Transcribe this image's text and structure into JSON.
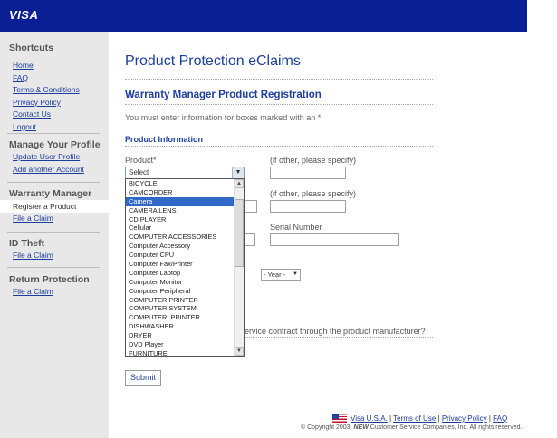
{
  "header": {
    "logo": "VISA"
  },
  "sidebar": {
    "shortcuts": {
      "title": "Shortcuts",
      "links": [
        "Home",
        "FAQ",
        "Terms & Conditions",
        "Privacy Policy",
        "Contact Us",
        "Logout"
      ]
    },
    "profile": {
      "title": "Manage Your Profile",
      "links": [
        "Update User Profile",
        "Add another Account"
      ]
    },
    "warranty": {
      "title": "Warranty Manager",
      "active": "Register a Product",
      "link": "File a Claim"
    },
    "idtheft": {
      "title": "ID Theft",
      "link": "File a Claim"
    },
    "returns": {
      "title": "Return Protection",
      "link": "File a Claim"
    }
  },
  "main": {
    "title": "Product Protection eClaims",
    "subtitle": "Warranty Manager Product Registration",
    "required_note": "You must enter information for boxes marked with an *",
    "section": "Product Information",
    "product_label": "Product*",
    "if_other_1": "(if other, please specify)",
    "if_other_2": "(if other, please specify)",
    "serial_label": "Serial Number",
    "product_select_value": "Select",
    "year_select": "- Year -",
    "question_partial": "ervice contract through the product manufacturer?",
    "submit_label": "Submit",
    "dropdown_options": [
      "BICYCLE",
      "CAMCORDER",
      "Camera",
      "CAMERA LENS",
      "CD PLAYER",
      "Cellular",
      "COMPUTER ACCESSORIES",
      "Computer Accessory",
      "Computer CPU",
      "Computer Fax/Printer",
      "Computer Laptop",
      "Computer Monitor",
      "Computer Peripheral",
      "COMPUTER PRINTER",
      "COMPUTER SYSTEM",
      "COMPUTER, PRINTER",
      "DISHWASHER",
      "DRYER",
      "DVD Player",
      "FURNITURE"
    ],
    "dropdown_selected": "Camera"
  },
  "footer": {
    "links": [
      "Visa U.S.A.",
      "Terms of Use",
      "Privacy Policy",
      "FAQ"
    ],
    "separator": "|",
    "copyright_pre": "© Copyright 2003,",
    "copyright_brand": "NEW",
    "copyright_post": "Customer Service Companies, Inc. All rights reserved."
  },
  "colors": {
    "header": "#0a1f94",
    "heading": "#1d3f9e",
    "sidebar": "#e8e8e8",
    "selected": "#3169c6"
  }
}
